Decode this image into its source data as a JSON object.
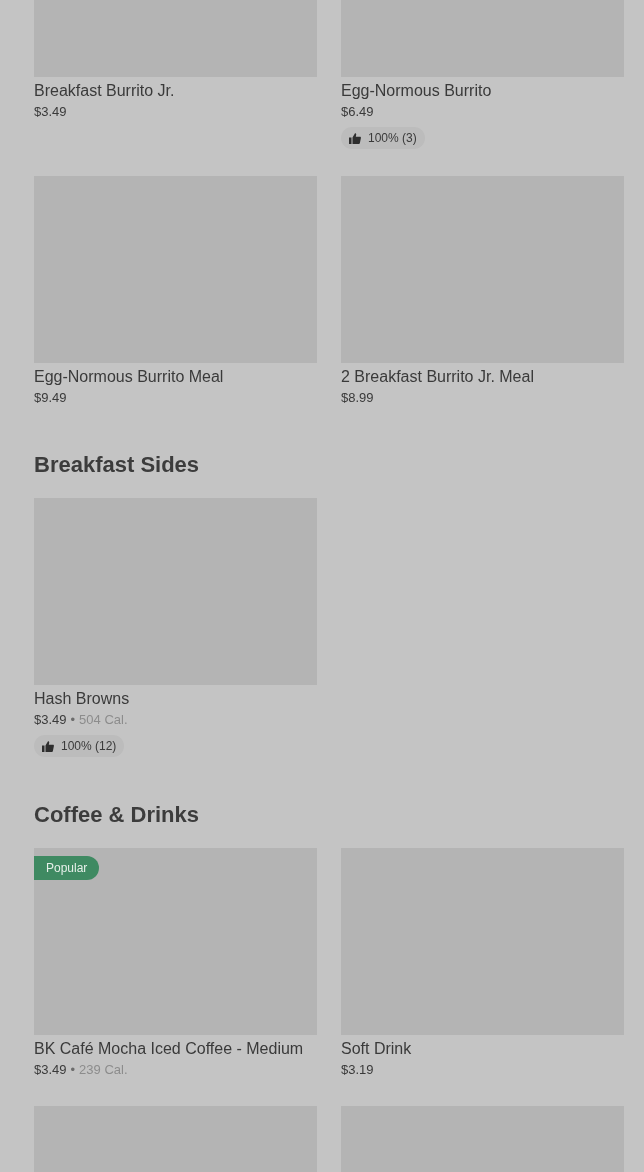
{
  "separator": "•",
  "sections": [
    {
      "items": [
        {
          "kind": "cut_top",
          "name": "Breakfast Burrito Jr.",
          "price": "$3.49"
        },
        {
          "kind": "cut_top",
          "name": "Egg-Normous Burrito",
          "price": "$6.49",
          "rating": "100% (3)"
        },
        {
          "kind": "full",
          "name": "Egg-Normous Burrito Meal",
          "price": "$9.49"
        },
        {
          "kind": "full",
          "name": "2 Breakfast Burrito Jr. Meal",
          "price": "$8.99"
        }
      ]
    },
    {
      "title": "Breakfast Sides",
      "items": [
        {
          "kind": "full",
          "name": "Hash Browns",
          "price": "$3.49",
          "calories": "504 Cal.",
          "rating": "100% (12)"
        }
      ]
    },
    {
      "title": "Coffee & Drinks",
      "items": [
        {
          "kind": "full",
          "badge": "Popular",
          "name": "BK Café Mocha Iced Coffee - Medium",
          "price": "$3.49",
          "calories": "239 Cal."
        },
        {
          "kind": "full",
          "name": "Soft Drink",
          "price": "$3.19"
        },
        {
          "kind": "cut_bottom"
        },
        {
          "kind": "cut_bottom"
        }
      ]
    }
  ]
}
